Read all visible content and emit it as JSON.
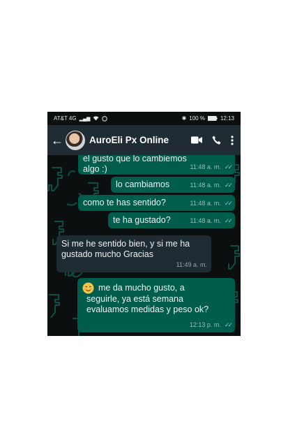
{
  "status_bar": {
    "carrier": "AT&T 4G",
    "battery": "100 %",
    "time": "12:13"
  },
  "header": {
    "contact_name": "AuroEli Px Online"
  },
  "messages": [
    {
      "direction": "out",
      "text_line1": "el gusto que lo cambiemos",
      "text_line2": "algo :)",
      "time": "11:48 a. m."
    },
    {
      "direction": "out",
      "text": "lo cambiamos",
      "time": "11:48 a. m."
    },
    {
      "direction": "out",
      "text": "como te has sentido?",
      "time": "11:48 a. m."
    },
    {
      "direction": "out",
      "text": "te ha gustado?",
      "time": "11:48 a. m."
    },
    {
      "direction": "in",
      "text_line1": "Si me he sentido bien, y si me ha",
      "text_line2": "gustado mucho Gracias",
      "time": "11:49 a. m."
    },
    {
      "direction": "out",
      "text_line1": "me da mucho gusto, a",
      "text_line2": "seguirle, ya está semana",
      "text_line3": "evaluamos medidas y peso ok?",
      "time": "12:13 p. m."
    }
  ],
  "colors": {
    "outgoing_bubble": "#005c4b",
    "incoming_bubble": "#1f2c33",
    "header": "#1f2c33",
    "wallpaper_pattern": "#0f4d45",
    "read_ticks": "#8fc2d6"
  }
}
